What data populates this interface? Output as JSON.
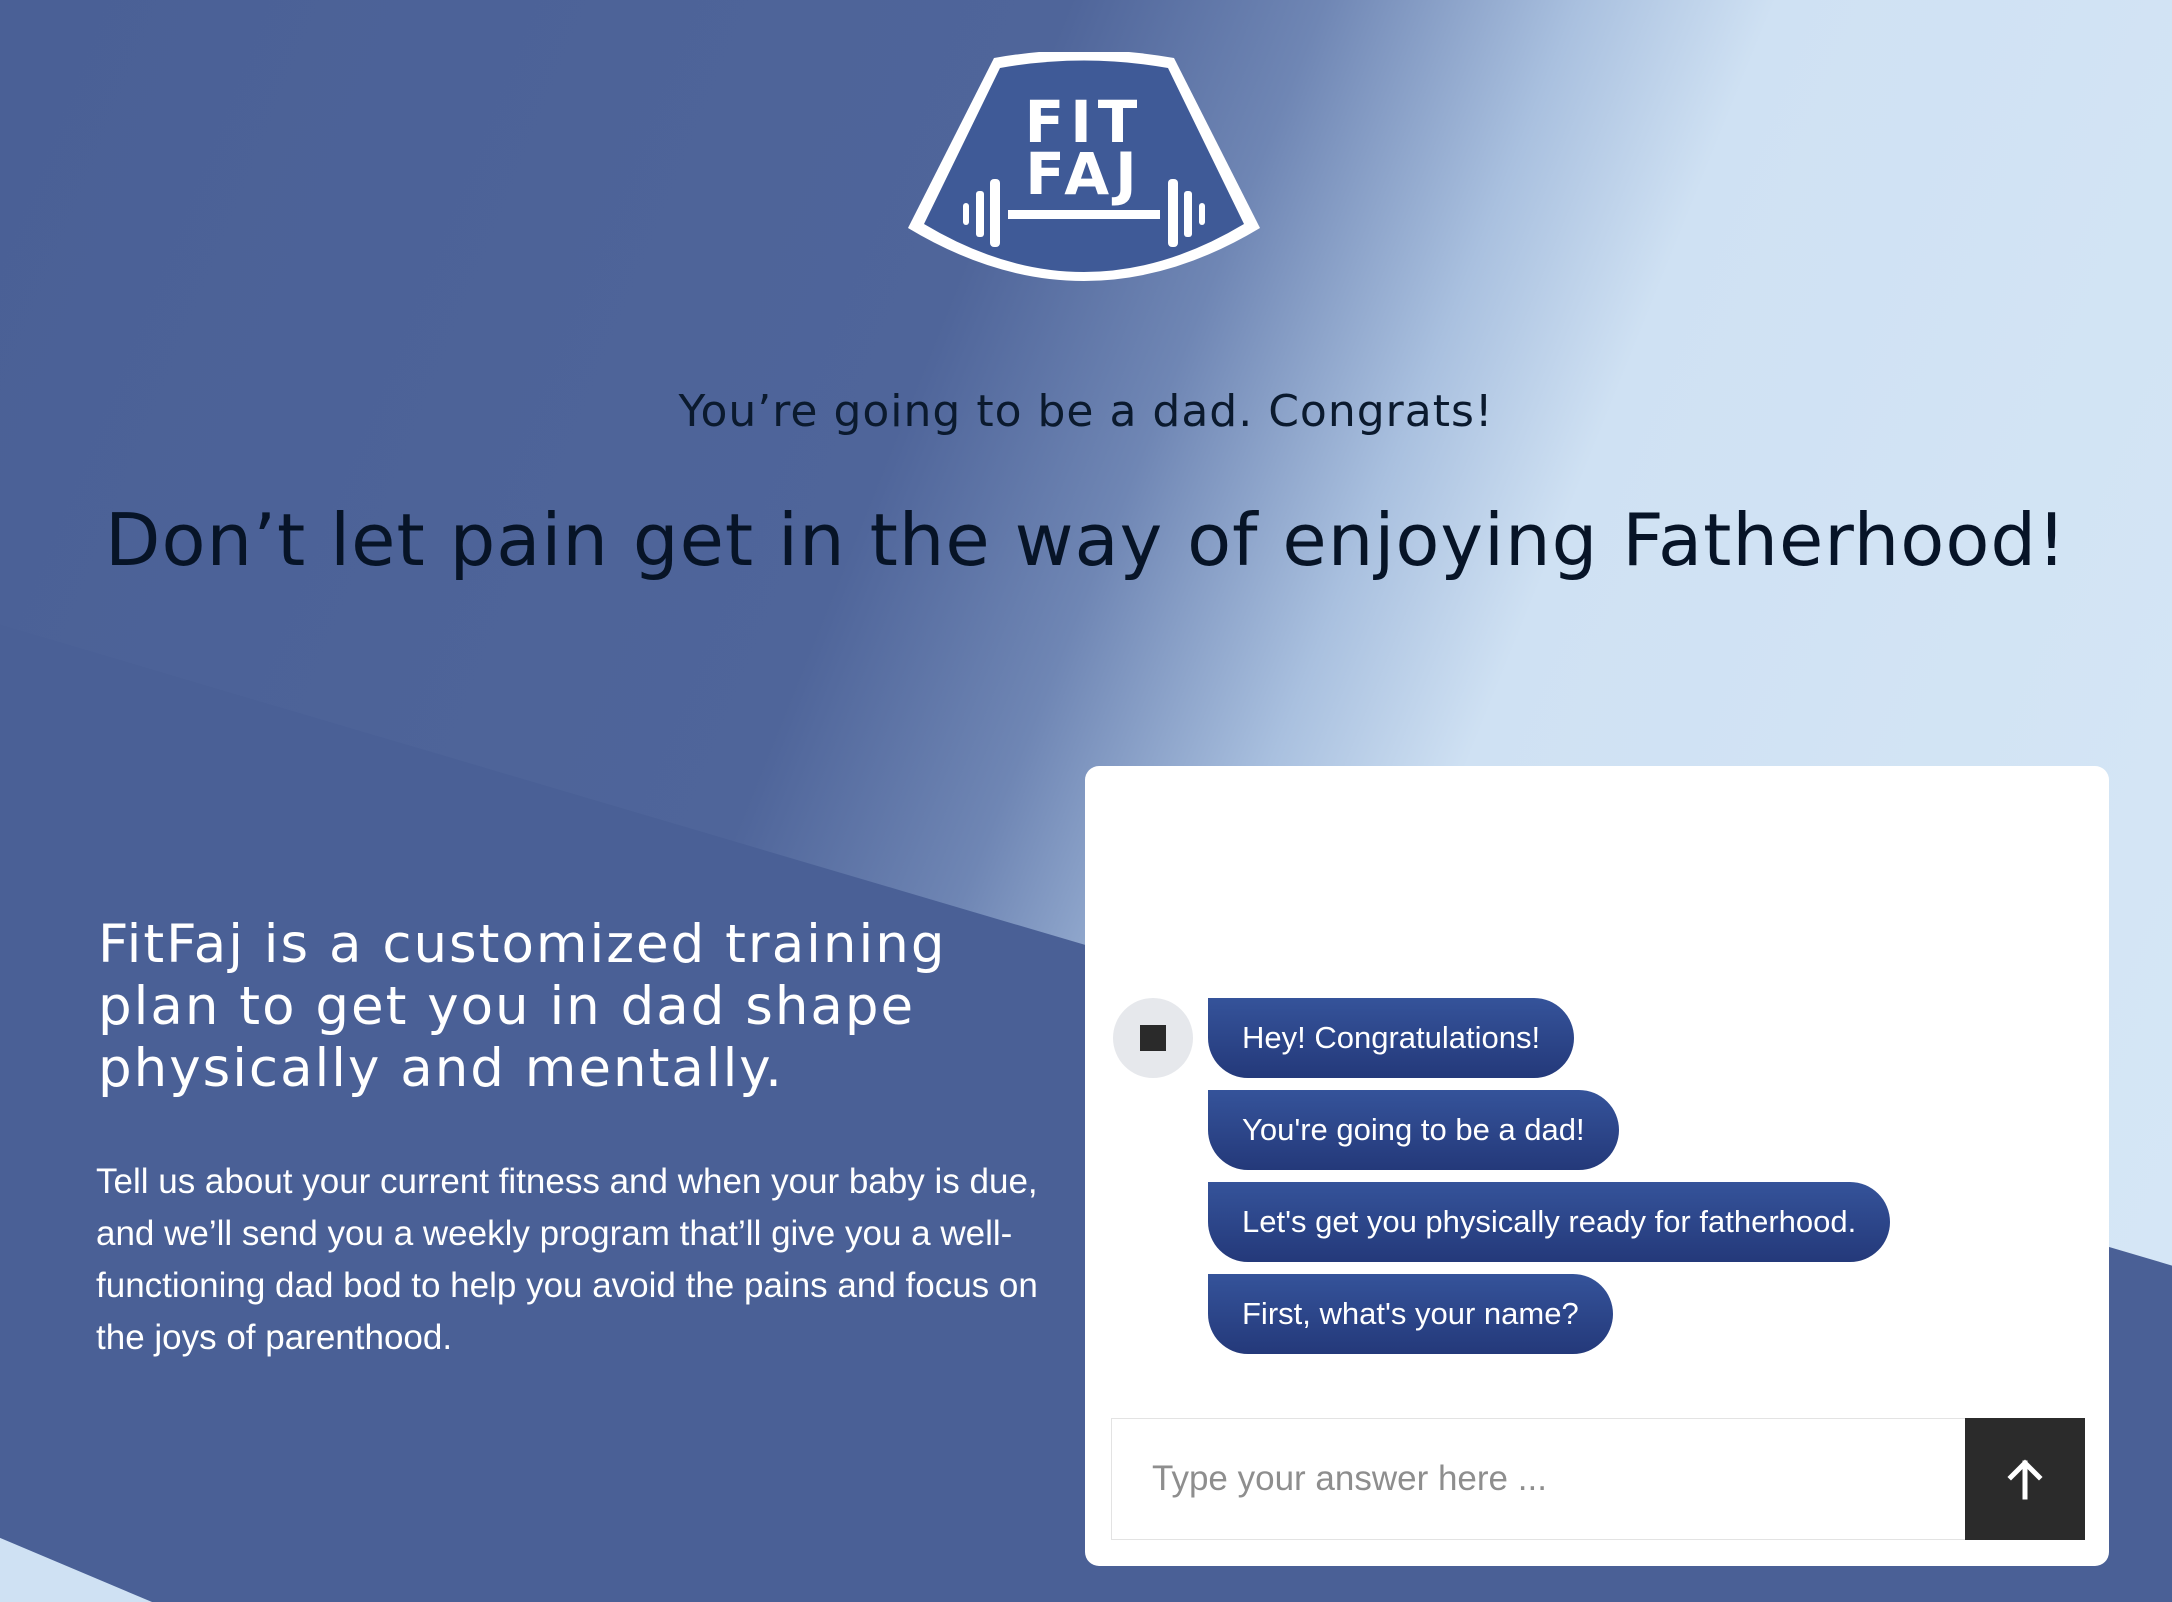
{
  "logo": {
    "line1": "FIT",
    "line2": "FAJ",
    "icon": "barbell-icon",
    "color": "#3f5a97"
  },
  "hero": {
    "tagline": "You’re going to be a dad. Congrats!",
    "headline": "Don’t let pain get in the way of enjoying Fatherhood!"
  },
  "intro": {
    "title": "FitFaj is a customized training plan to get you in dad shape physically and mentally.",
    "body": "Tell us about your current fitness and when your baby is due, and we’ll send you a weekly program that’ll give you a well-functioning dad bod to help you avoid the pains and focus on the joys of parenthood."
  },
  "chat": {
    "avatar_icon": "bot-avatar-icon",
    "messages": [
      {
        "text": "Hey! Congratulations!"
      },
      {
        "text": "You're going to be a dad!"
      },
      {
        "text": "Let's get you physically ready for fatherhood."
      },
      {
        "text": "First, what's your name?"
      }
    ],
    "input": {
      "placeholder": "Type your answer here ...",
      "value": ""
    },
    "send_icon": "arrow-up-icon"
  },
  "colors": {
    "background_dark": "#4a6096",
    "background_light": "#d6e7f6",
    "bubble": "#2c4488",
    "send_button": "#2b2b2b"
  }
}
